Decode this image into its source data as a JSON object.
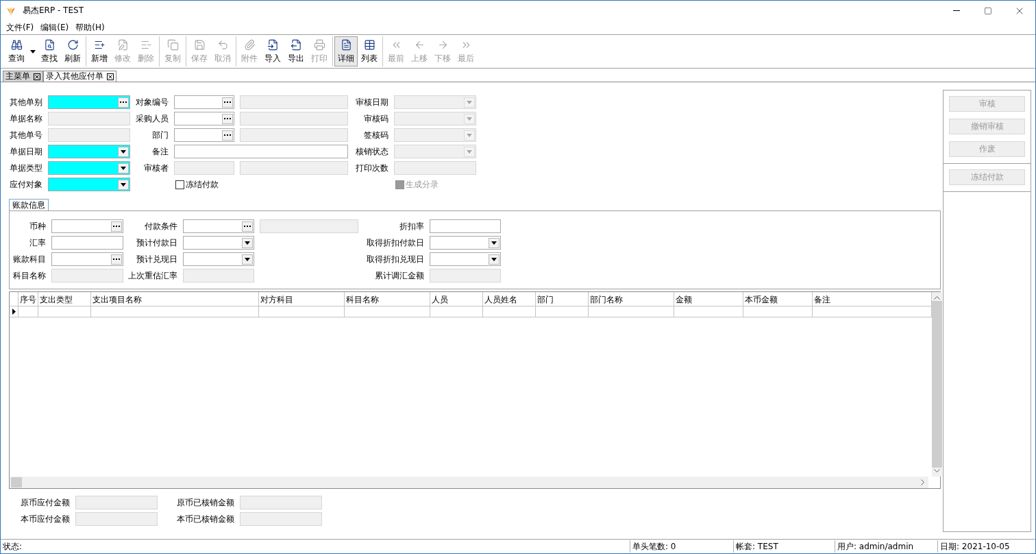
{
  "window": {
    "title": "易杰ERP - TEST"
  },
  "menu": [
    "文件(F)",
    "编辑(E)",
    "帮助(H)"
  ],
  "toolbar": {
    "groups": [
      {
        "items": [
          {
            "label": "查询",
            "disabled": false,
            "selected": false,
            "menu": true
          },
          {
            "label": "查找",
            "disabled": false,
            "selected": false
          },
          {
            "label": "刷新",
            "disabled": false,
            "selected": false
          }
        ]
      },
      {
        "items": [
          {
            "label": "新增",
            "disabled": false,
            "selected": false
          },
          {
            "label": "修改",
            "disabled": true,
            "selected": false
          },
          {
            "label": "删除",
            "disabled": true,
            "selected": false
          }
        ]
      },
      {
        "items": [
          {
            "label": "复制",
            "disabled": true,
            "selected": false
          }
        ]
      },
      {
        "items": [
          {
            "label": "保存",
            "disabled": true,
            "selected": false
          },
          {
            "label": "取消",
            "disabled": true,
            "selected": false
          }
        ]
      },
      {
        "items": [
          {
            "label": "附件",
            "disabled": true,
            "selected": false
          },
          {
            "label": "导入",
            "disabled": false,
            "selected": false
          },
          {
            "label": "导出",
            "disabled": false,
            "selected": false
          },
          {
            "label": "打印",
            "disabled": true,
            "selected": false
          }
        ]
      },
      {
        "items": [
          {
            "label": "详细",
            "disabled": false,
            "selected": true
          },
          {
            "label": "列表",
            "disabled": false,
            "selected": false
          }
        ]
      },
      {
        "items": [
          {
            "label": "最前",
            "disabled": true,
            "selected": false
          },
          {
            "label": "上移",
            "disabled": true,
            "selected": false
          },
          {
            "label": "下移",
            "disabled": true,
            "selected": false
          },
          {
            "label": "最后",
            "disabled": true,
            "selected": false
          }
        ]
      }
    ]
  },
  "tabs": [
    {
      "label": "主菜单",
      "selected": false
    },
    {
      "label": "录入其他应付单",
      "selected": true
    }
  ],
  "header": {
    "columns": [
      [
        {
          "kind": "field",
          "label": "其他单别",
          "field": {
            "kind": "lookup",
            "required": true,
            "disabled": false
          }
        },
        {
          "kind": "field",
          "label": "单据名称",
          "field": {
            "kind": "text",
            "required": false,
            "disabled": true
          }
        },
        {
          "kind": "field",
          "label": "其他单号",
          "field": {
            "kind": "text",
            "required": false,
            "disabled": true
          }
        },
        {
          "kind": "field",
          "label": "单据日期",
          "field": {
            "kind": "combo",
            "required": true,
            "disabled": false
          }
        },
        {
          "kind": "field",
          "label": "单据类型",
          "field": {
            "kind": "combo",
            "required": true,
            "disabled": false
          }
        },
        {
          "kind": "field",
          "label": "应付对象",
          "field": {
            "kind": "combo",
            "required": true,
            "disabled": false
          }
        }
      ],
      [
        {
          "kind": "field",
          "label": "对象编号",
          "field": {
            "kind": "lookup",
            "required": false,
            "disabled": false
          },
          "extra": {
            "kind": "text",
            "required": false,
            "disabled": true
          }
        },
        {
          "kind": "field",
          "label": "采购人员",
          "field": {
            "kind": "lookup",
            "required": false,
            "disabled": false
          },
          "extra": {
            "kind": "text",
            "required": false,
            "disabled": true
          }
        },
        {
          "kind": "field",
          "label": "部门",
          "field": {
            "kind": "lookup",
            "required": false,
            "disabled": false
          },
          "extra": {
            "kind": "text",
            "required": false,
            "disabled": true
          }
        },
        {
          "kind": "wide",
          "label": "备注",
          "field": {
            "kind": "text",
            "required": false,
            "disabled": false
          }
        },
        {
          "kind": "field",
          "label": "审核者",
          "field": {
            "kind": "text",
            "required": false,
            "disabled": true
          },
          "extra": {
            "kind": "text",
            "required": false,
            "disabled": true
          }
        },
        {
          "kind": "checkbox",
          "label": "冻结付款",
          "checked": false,
          "disabled": false
        }
      ],
      [
        {
          "kind": "field",
          "label": "审核日期",
          "field": {
            "kind": "combo",
            "required": false,
            "disabled": true
          }
        },
        {
          "kind": "field",
          "label": "审核码",
          "field": {
            "kind": "combo",
            "required": false,
            "disabled": true
          }
        },
        {
          "kind": "field",
          "label": "签核码",
          "field": {
            "kind": "combo",
            "required": false,
            "disabled": true
          }
        },
        {
          "kind": "field",
          "label": "核销状态",
          "field": {
            "kind": "combo",
            "required": false,
            "disabled": true
          }
        },
        {
          "kind": "field",
          "label": "打印次数",
          "field": {
            "kind": "text",
            "required": false,
            "disabled": true
          }
        },
        {
          "kind": "checkbox",
          "label": "生成分录",
          "checked": false,
          "disabled": true
        }
      ]
    ]
  },
  "payment": {
    "title": "账款信息",
    "columns": [
      [
        {
          "kind": "field",
          "label": "币种",
          "field": {
            "kind": "lookup",
            "required": false,
            "disabled": false
          }
        },
        {
          "kind": "field",
          "label": "汇率",
          "field": {
            "kind": "text",
            "required": false,
            "disabled": false
          }
        },
        {
          "kind": "field",
          "label": "账款科目",
          "field": {
            "kind": "lookup",
            "required": false,
            "disabled": false
          }
        },
        {
          "kind": "field",
          "label": "科目名称",
          "field": {
            "kind": "text",
            "required": false,
            "disabled": true
          }
        }
      ],
      [
        {
          "kind": "field",
          "label": "付款条件",
          "field": {
            "kind": "lookup",
            "required": false,
            "disabled": false
          },
          "extra": {
            "kind": "text",
            "required": false,
            "disabled": true
          }
        },
        {
          "kind": "field",
          "label": "预计付款日",
          "field": {
            "kind": "combo",
            "required": false,
            "disabled": false
          }
        },
        {
          "kind": "field",
          "label": "预计兑现日",
          "field": {
            "kind": "combo",
            "required": false,
            "disabled": false
          }
        },
        {
          "kind": "field",
          "label": "上次重估汇率",
          "field": {
            "kind": "text",
            "required": false,
            "disabled": true
          }
        }
      ],
      [
        {
          "kind": "field",
          "label": "折扣率",
          "field": {
            "kind": "text",
            "required": false,
            "disabled": false
          }
        },
        {
          "kind": "field",
          "label": "取得折扣付款日",
          "field": {
            "kind": "combo",
            "required": false,
            "disabled": false
          }
        },
        {
          "kind": "field",
          "label": "取得折扣兑现日",
          "field": {
            "kind": "combo",
            "required": false,
            "disabled": false
          }
        },
        {
          "kind": "field",
          "label": "累计调汇金额",
          "field": {
            "kind": "text",
            "required": false,
            "disabled": true
          }
        }
      ]
    ]
  },
  "grid": {
    "columns": [
      "序号",
      "支出类型",
      "支出项目名称",
      "对方科目",
      "科目名称",
      "人员",
      "人员姓名",
      "部门",
      "部门名称",
      "金额",
      "本币金额",
      "备注"
    ],
    "rows": [
      {
        "current": true
      }
    ]
  },
  "totals": {
    "columns": [
      [
        {
          "kind": "field",
          "label": "原币应付金额",
          "field": {
            "kind": "text",
            "required": false,
            "disabled": true
          }
        },
        {
          "kind": "field",
          "label": "本币应付金额",
          "field": {
            "kind": "text",
            "required": false,
            "disabled": true
          }
        }
      ],
      [
        {
          "kind": "field",
          "label": "原币已核销金额",
          "field": {
            "kind": "text",
            "required": false,
            "disabled": true
          }
        },
        {
          "kind": "field",
          "label": "本币已核销金额",
          "field": {
            "kind": "text",
            "required": false,
            "disabled": true
          }
        }
      ]
    ]
  },
  "actions": {
    "groups": [
      {
        "buttons": [
          {
            "label": "审核",
            "disabled": true
          },
          {
            "label": "撤销审核",
            "disabled": true
          },
          {
            "label": "作废",
            "disabled": true
          }
        ]
      },
      {
        "buttons": [
          {
            "label": "冻结付款",
            "disabled": true
          }
        ]
      }
    ]
  },
  "status_bar": {
    "message": "状态:",
    "panels": [
      "单头笔数: 0",
      "帐套: TEST",
      "用户: admin/admin",
      "日期: 2021-10-05"
    ]
  }
}
